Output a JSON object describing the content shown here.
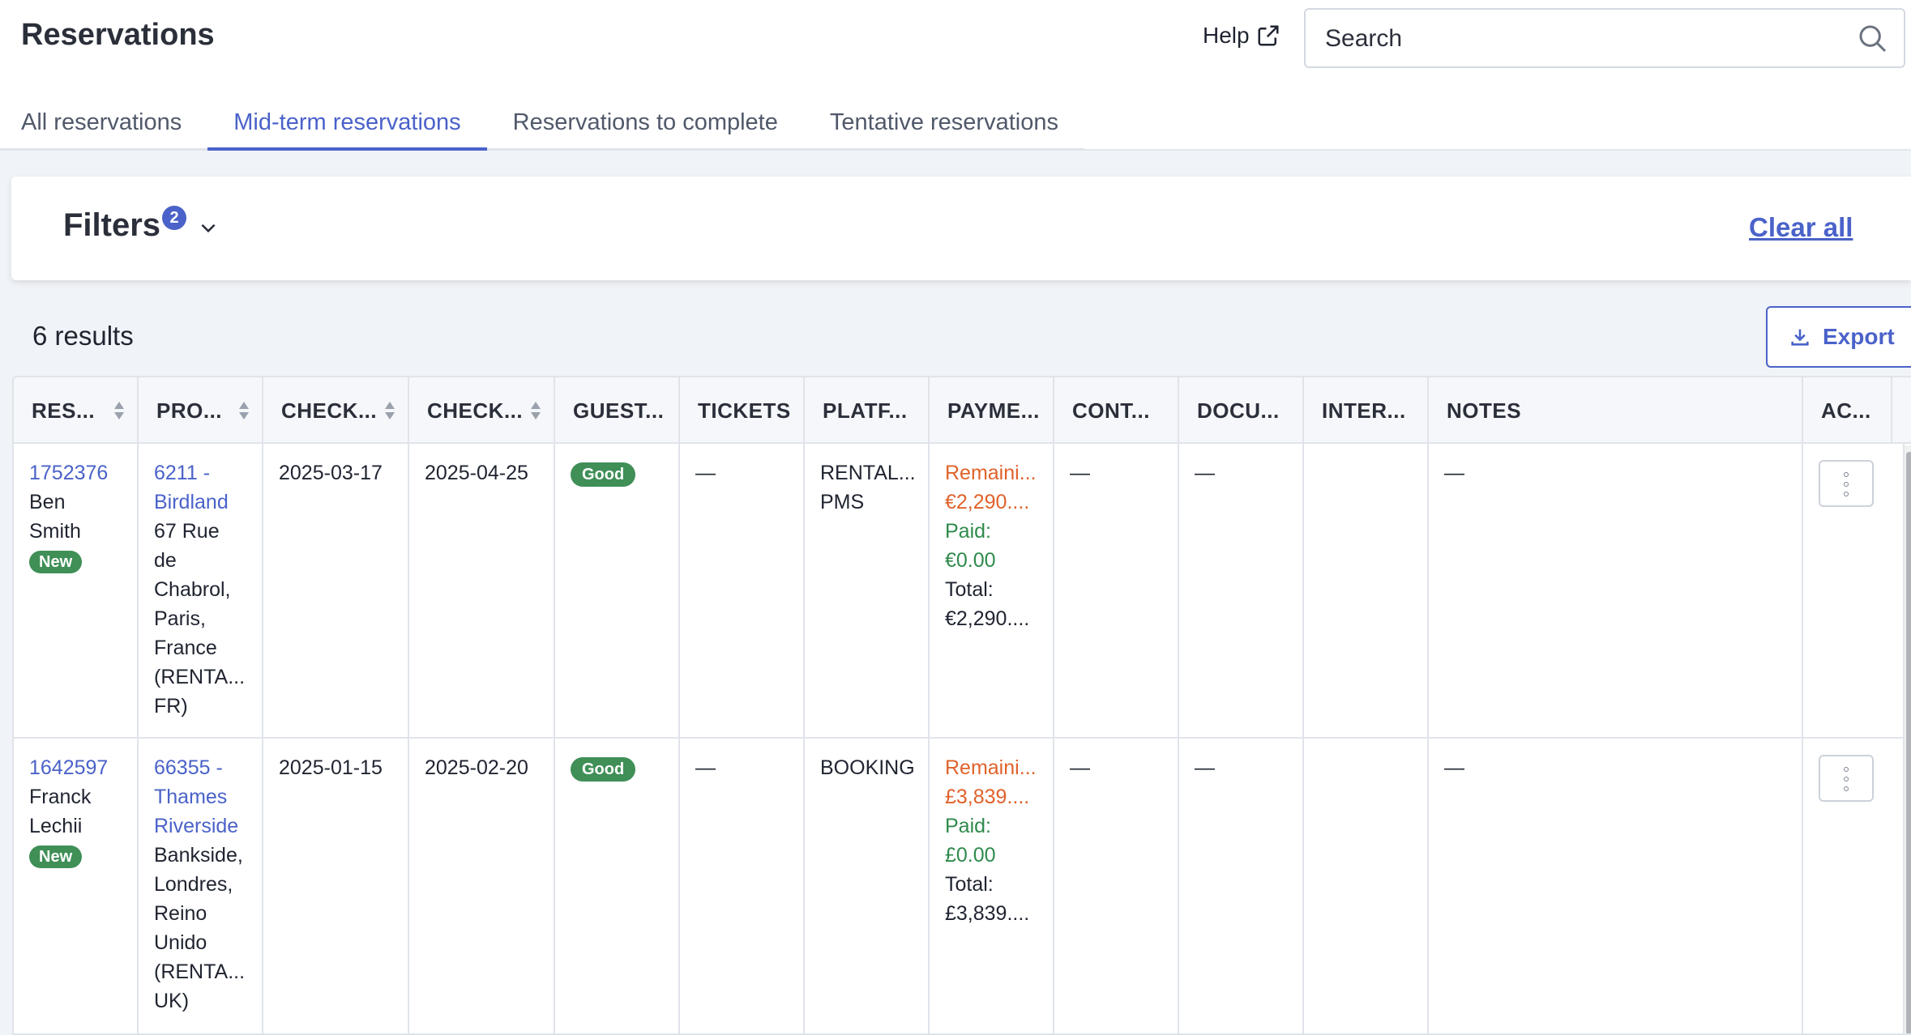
{
  "header": {
    "title": "Reservations",
    "help_label": "Help",
    "search_placeholder": "Search"
  },
  "tabs": [
    {
      "label": "All reservations",
      "active": false
    },
    {
      "label": "Mid-term reservations",
      "active": true
    },
    {
      "label": "Reservations to complete",
      "active": false
    },
    {
      "label": "Tentative reservations",
      "active": false
    }
  ],
  "filters": {
    "label": "Filters",
    "count": "2",
    "clear_all": "Clear all"
  },
  "results": {
    "summary": "6 results",
    "export_label": "Export"
  },
  "table": {
    "columns": [
      "RES...",
      "PRO...",
      "CHECK...",
      "CHECK...",
      "GUEST...",
      "TICKETS",
      "PLATF...",
      "PAYME...",
      "CONT...",
      "DOCU...",
      "INTER...",
      "NOTES",
      "AC..."
    ],
    "rows": [
      {
        "res_id": "1752376",
        "guest_first": "Ben",
        "guest_last": "Smith",
        "status": "New",
        "property_link_1": "6211 -",
        "property_link_2": "Birdland",
        "address": [
          "67 Rue",
          "de",
          "Chabrol,",
          "Paris,",
          "France",
          "(RENTA...",
          "FR)"
        ],
        "checkin": "2025-03-17",
        "checkout": "2025-04-25",
        "guest_rating": "Good",
        "tickets": "—",
        "platform": [
          "RENTAL...",
          "PMS"
        ],
        "payment_remaining_label": "Remaini...",
        "payment_remaining_value": "€2,290....",
        "payment_paid_label": "Paid:",
        "payment_paid_value": "€0.00",
        "payment_total_label": "Total:",
        "payment_total_value": "€2,290....",
        "contacts": "—",
        "documents": "—",
        "internal": "",
        "notes": "—"
      },
      {
        "res_id": "1642597",
        "guest_first": "Franck",
        "guest_last": "Lechii",
        "status": "New",
        "property_link_1": "66355 -",
        "property_link_2": "Thames",
        "property_link_3": "Riverside",
        "address": [
          "Bankside,",
          "Londres,",
          "Reino",
          "Unido",
          "(RENTA...",
          "UK)"
        ],
        "checkin": "2025-01-15",
        "checkout": "2025-02-20",
        "guest_rating": "Good",
        "tickets": "—",
        "platform": [
          "BOOKING"
        ],
        "payment_remaining_label": "Remaini...",
        "payment_remaining_value": "£3,839....",
        "payment_paid_label": "Paid:",
        "payment_paid_value": "£0.00",
        "payment_total_label": "Total:",
        "payment_total_value": "£3,839....",
        "contacts": "—",
        "documents": "—",
        "internal": "",
        "notes": "—"
      }
    ]
  },
  "colors": {
    "accent": "#4a62c9",
    "good_badge": "#3f8f57",
    "remaining": "#e0622b",
    "paid": "#2f8a4c"
  }
}
